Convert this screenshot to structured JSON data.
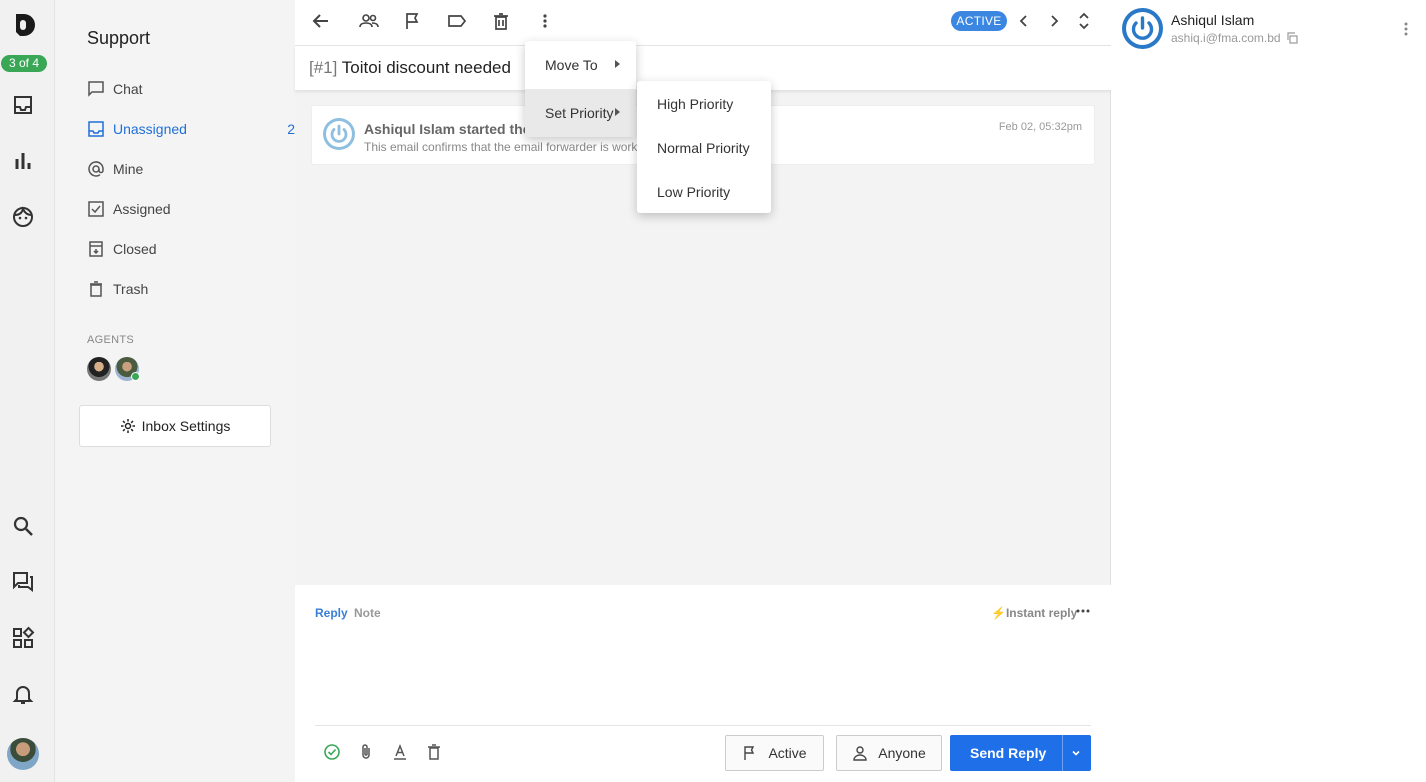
{
  "rail": {
    "counter_badge": "3 of 4",
    "icons": [
      "inbox-icon",
      "bar-chart-icon",
      "face-icon",
      "search-icon",
      "forum-icon",
      "apps-icon",
      "bell-icon"
    ]
  },
  "inbox": {
    "title": "Support",
    "items": [
      {
        "label": "Chat",
        "icon": "chat-icon"
      },
      {
        "label": "Unassigned",
        "icon": "inbox-icon",
        "count": "2",
        "active": true
      },
      {
        "label": "Mine",
        "icon": "at-icon"
      },
      {
        "label": "Assigned",
        "icon": "check-box-icon"
      },
      {
        "label": "Closed",
        "icon": "archive-icon"
      },
      {
        "label": "Trash",
        "icon": "trash-icon"
      }
    ],
    "agents_label": "AGENTS",
    "settings_label": "Inbox Settings"
  },
  "toolbar": {
    "status": "ACTIVE",
    "accent": "#3a86e0"
  },
  "conversation": {
    "id": "[#1]",
    "subject": "Toitoi discount needed",
    "message": {
      "author_line": "Ashiqul Islam started the c",
      "preview": "This email confirms that the email forwarder is work",
      "time": "Feb 02, 05:32pm"
    }
  },
  "menu": {
    "items": [
      "Move To",
      "Set Priority"
    ],
    "priority_items": [
      "High Priority",
      "Normal Priority",
      "Low Priority"
    ]
  },
  "reply": {
    "tab_reply": "Reply",
    "tab_note": "Note",
    "instant": "Instant reply",
    "status_button": "Active",
    "assignee_button": "Anyone",
    "send_button": "Send Reply",
    "send_color": "#1f6fe8"
  },
  "contact": {
    "name": "Ashiqul Islam",
    "email": "ashiq.i@fma.com.bd"
  }
}
